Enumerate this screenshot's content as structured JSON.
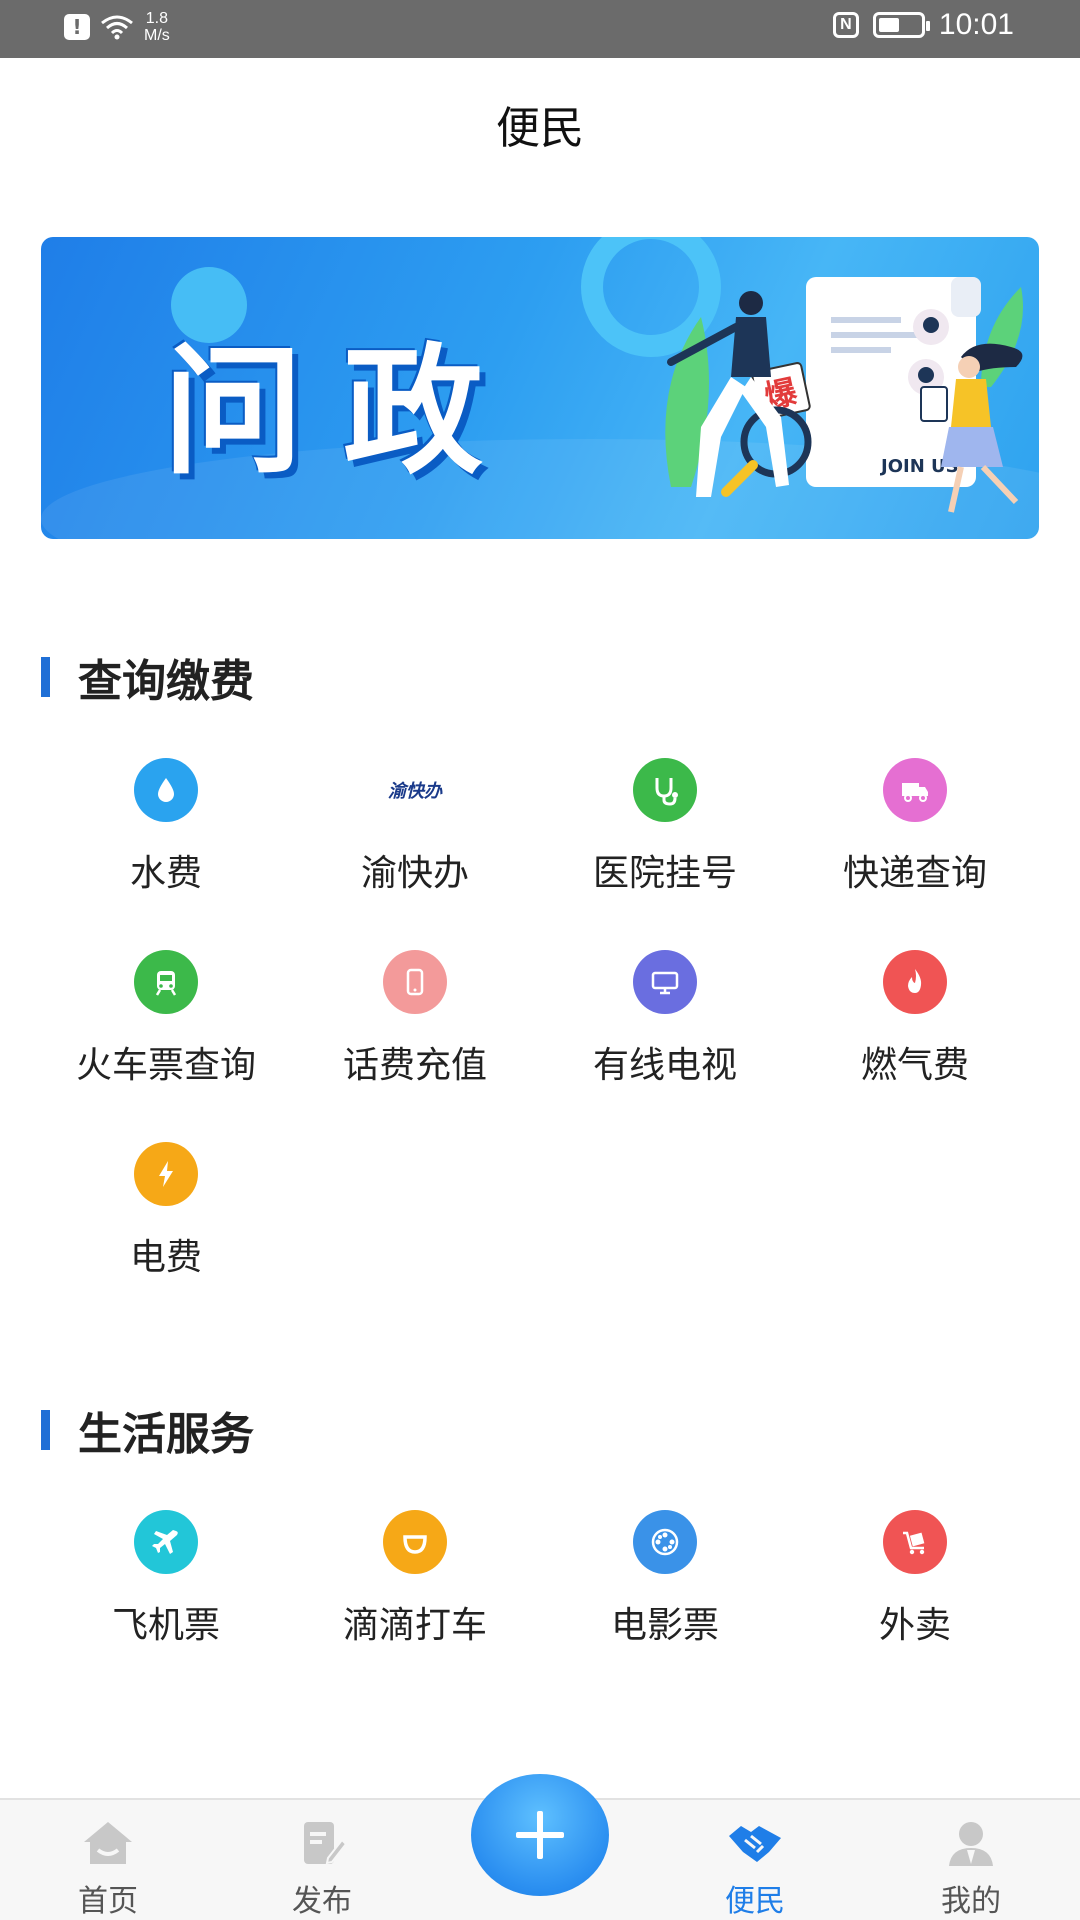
{
  "status_bar": {
    "speed_value": "1.8",
    "speed_unit": "M/s",
    "nfc": "N",
    "time": "10:01"
  },
  "header": {
    "title": "便民"
  },
  "banner": {
    "title": "问政",
    "join_text": "JOIN US",
    "badge": "爆"
  },
  "sections": {
    "query": {
      "title": "查询缴费",
      "items": [
        {
          "label": "水费",
          "icon": "water-drop-icon",
          "color": "#2aa3ef"
        },
        {
          "label": "渝快办",
          "icon": "yukuaiban-logo",
          "logo_text": "渝快办",
          "color": "#1a3a8a"
        },
        {
          "label": "医院挂号",
          "icon": "stethoscope-icon",
          "color": "#3cb94a"
        },
        {
          "label": "快递查询",
          "icon": "delivery-truck-icon",
          "color": "#e56fd2"
        },
        {
          "label": "火车票查询",
          "icon": "train-icon",
          "color": "#3cb94a"
        },
        {
          "label": "话费充值",
          "icon": "phone-icon",
          "color": "#f39a9a"
        },
        {
          "label": "有线电视",
          "icon": "tv-icon",
          "color": "#6a6ee0"
        },
        {
          "label": "燃气费",
          "icon": "flame-icon",
          "color": "#f05454"
        },
        {
          "label": "电费",
          "icon": "lightning-icon",
          "color": "#f6a817"
        }
      ]
    },
    "life": {
      "title": "生活服务",
      "items": [
        {
          "label": "飞机票",
          "icon": "airplane-icon",
          "color": "#22c6d8"
        },
        {
          "label": "滴滴打车",
          "icon": "didi-icon",
          "color": "#f6a817"
        },
        {
          "label": "电影票",
          "icon": "film-reel-icon",
          "color": "#3a92e8"
        },
        {
          "label": "外卖",
          "icon": "takeout-cart-icon",
          "color": "#f05454"
        }
      ]
    }
  },
  "bottom_nav": {
    "items": [
      {
        "label": "首页",
        "icon": "home-icon"
      },
      {
        "label": "发布",
        "icon": "publish-icon"
      },
      {
        "label": "便民",
        "icon": "handshake-icon",
        "active": true
      },
      {
        "label": "我的",
        "icon": "profile-icon"
      }
    ],
    "fab_icon": "plus-icon",
    "accent": "#1f7ee8"
  }
}
